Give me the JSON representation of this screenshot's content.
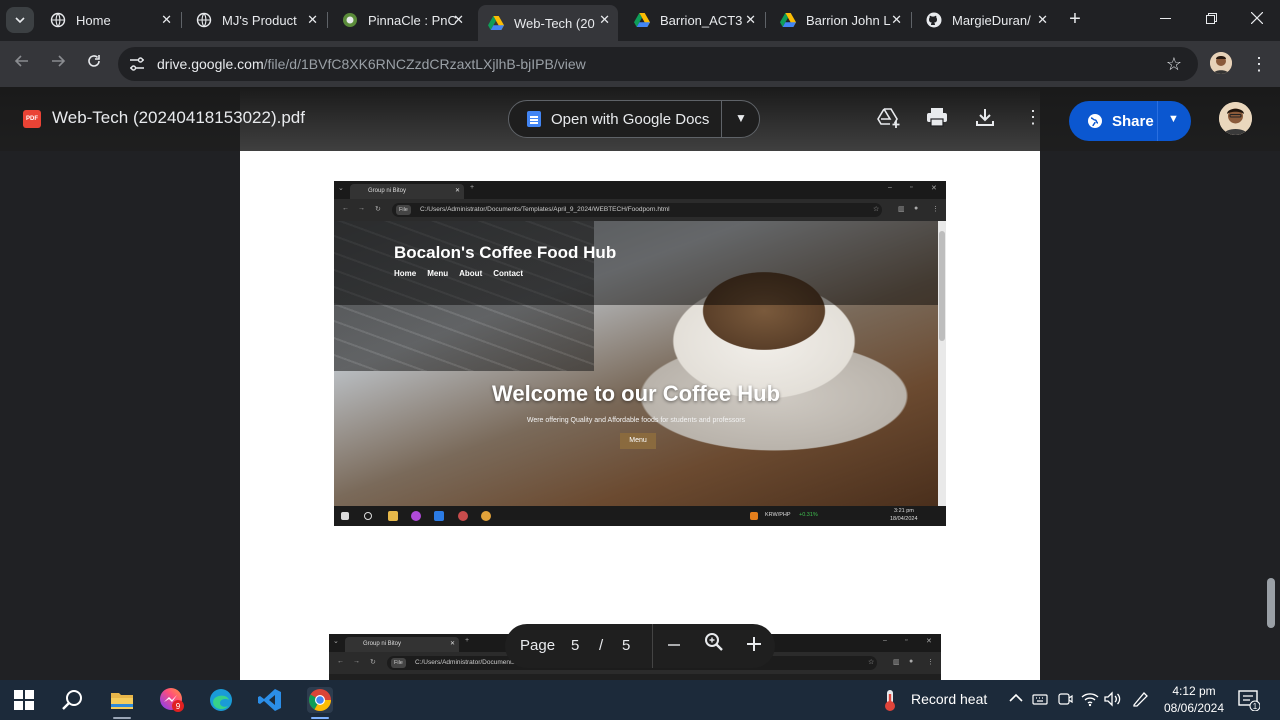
{
  "browser": {
    "tabs": [
      {
        "label": "Home",
        "icon": "globe-icon",
        "active": false
      },
      {
        "label": "MJ's Product",
        "icon": "globe-icon",
        "active": false
      },
      {
        "label": "PinnaCle : PnC",
        "icon": "pinnacle-icon",
        "active": false
      },
      {
        "label": "Web-Tech (20",
        "icon": "drive-icon",
        "active": true
      },
      {
        "label": "Barrion_ACT3",
        "icon": "drive-icon",
        "active": false
      },
      {
        "label": "Barrion John L",
        "icon": "drive-icon",
        "active": false
      },
      {
        "label": "MargieDuran/",
        "icon": "github-icon",
        "active": false
      }
    ],
    "url_host": "drive.google.com",
    "url_path": "/file/d/1BVfC8XK6RNCZzdCRzaxtLXjlhB-bjIPB/view"
  },
  "viewer": {
    "file_name": "Web-Tech (20240418153022).pdf",
    "file_badge": "PDF",
    "open_with_label": "Open with Google Docs",
    "share_label": "Share",
    "page_label": "Page",
    "current_page": "5",
    "separator": "/",
    "total_pages": "5"
  },
  "embedded": {
    "tab_title": "Group ni Bitoy",
    "file_chip": "File",
    "address": "C:/Users/Administrator/Documents/Templates/April_9_2024/WEBTECH/Foodporn.html",
    "site_brand": "Bocalon's Coffee Food Hub",
    "nav_links": [
      "Home",
      "Menu",
      "About",
      "Contact"
    ],
    "hero_title": "Welcome to our Coffee Hub",
    "hero_tagline": "Were offering Quality and Affordable foods for students and professors",
    "menu_button": "Menu",
    "ticker": "KRW/PHP",
    "ticker_change": "+0.31%",
    "clock_time": "3:21 pm",
    "clock_date": "18/04/2024"
  },
  "taskbar": {
    "weather": "Record heat",
    "time": "4:12 pm",
    "date": "08/06/2024",
    "notif_count": "1",
    "messenger_badge": "9"
  },
  "colors": {
    "accent": "#0b57d0",
    "pdf_red": "#ea4335",
    "positive": "#3fbf4f"
  }
}
